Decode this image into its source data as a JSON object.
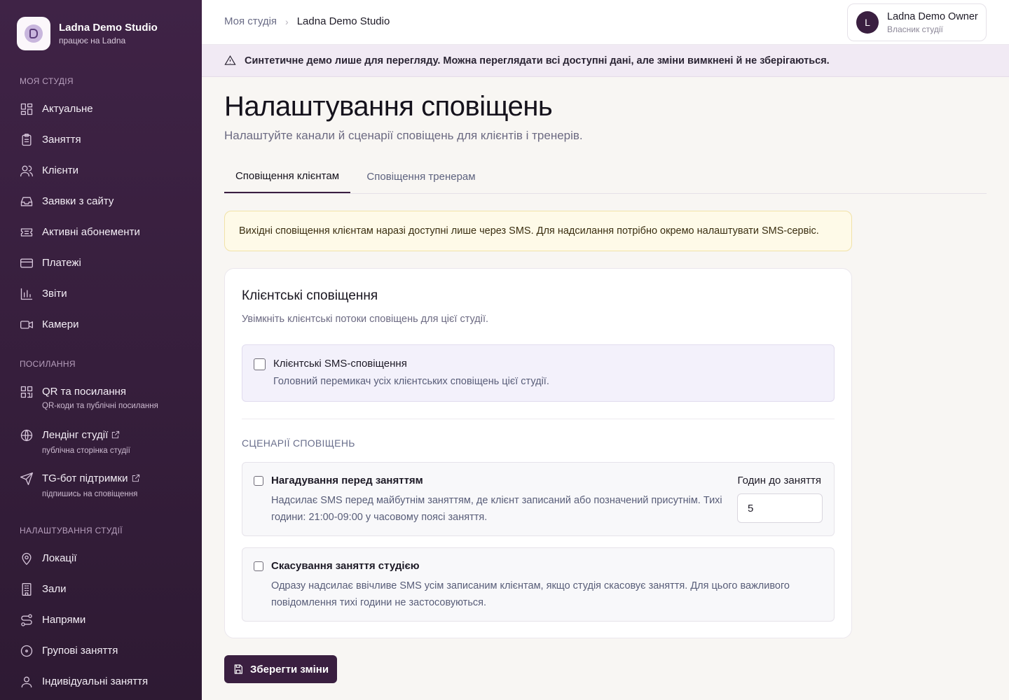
{
  "brand": {
    "name": "Ladna Demo Studio",
    "subtitle": "працює на Ladna"
  },
  "sidebar": {
    "sections": {
      "my_studio": "МОЯ СТУДІЯ",
      "links": "ПОСИЛАННЯ",
      "settings": "НАЛАШТУВАННЯ СТУДІЇ"
    },
    "items": [
      {
        "label": "Актуальне",
        "icon": "dashboard-icon"
      },
      {
        "label": "Заняття",
        "icon": "clipboard-icon"
      },
      {
        "label": "Клієнти",
        "icon": "users-icon"
      },
      {
        "label": "Заявки з сайту",
        "icon": "inbox-icon"
      },
      {
        "label": "Активні абонементи",
        "icon": "ticket-icon"
      },
      {
        "label": "Платежі",
        "icon": "credit-card-icon"
      },
      {
        "label": "Звіти",
        "icon": "bar-chart-icon"
      },
      {
        "label": "Камери",
        "icon": "video-icon"
      }
    ],
    "links": [
      {
        "label": "QR та посилання",
        "sub": "QR-коди та публічні посилання",
        "icon": "qr-icon"
      },
      {
        "label": "Лендінг студії",
        "sub": "публічна сторінка студії",
        "icon": "globe-icon"
      },
      {
        "label": "TG-бот підтримки",
        "sub": "підпишись на сповіщення",
        "icon": "send-icon"
      }
    ],
    "settings": [
      {
        "label": "Локації",
        "icon": "map-pin-icon"
      },
      {
        "label": "Зали",
        "icon": "building-icon"
      },
      {
        "label": "Напрями",
        "icon": "route-icon"
      },
      {
        "label": "Групові заняття",
        "icon": "circle-icon"
      },
      {
        "label": "Індивідуальні заняття",
        "icon": "user-icon"
      }
    ]
  },
  "header": {
    "breadcrumb": [
      "Моя студія",
      "Ladna Demo Studio"
    ],
    "user": {
      "initial": "L",
      "name": "Ladna Demo Owner",
      "role": "Власник студії"
    }
  },
  "demo_banner": "Синтетичне демо лише для перегляду. Можна переглядати всі доступні дані, але зміни вимкнені й не зберігаються.",
  "page": {
    "title": "Налаштування сповіщень",
    "subtitle": "Налаштуйте канали й сценарії сповіщень для клієнтів і тренерів."
  },
  "tabs": [
    {
      "label": "Сповіщення клієнтам",
      "active": true
    },
    {
      "label": "Сповіщення тренерам",
      "active": false
    }
  ],
  "info_note": "Вихідні сповіщення клієнтам наразі доступні лише через SMS. Для надсилання потрібно окремо налаштувати SMS-сервіс.",
  "card": {
    "title": "Клієнтські сповіщення",
    "subtitle": "Увімкніть клієнтські потоки сповіщень для цієї студії.",
    "master": {
      "title": "Клієнтські SMS-сповіщення",
      "desc": "Головний перемикач усіх клієнтських сповіщень цієї студії.",
      "checked": false
    },
    "scenarios_caption": "СЦЕНАРІЇ СПОВІЩЕНЬ",
    "scenarios": [
      {
        "title": "Нагадування перед заняттям",
        "desc_line1": "Надсилає SMS перед майбутнім заняттям, де клієнт записаний або позначений присутнім. Тихі",
        "desc_line2": "години: 21:00-09:00 у часовому поясі заняття.",
        "hours_label": "Годин до заняття",
        "hours_value": "5",
        "checked": false
      },
      {
        "title": "Скасування заняття студією",
        "desc_line1": "Одразу надсилає ввічливе SMS усім записаним клієнтам, якщо студія скасовує заняття. Для цього важливого",
        "desc_line2": "повідомлення тихі години не застосовуються.",
        "checked": false
      }
    ]
  },
  "save_button": "Зберегти зміни",
  "colors": {
    "sidebar": "#3f2346",
    "accent": "#3a1f40",
    "banner": "#f1eaf4",
    "note": "#fefae8"
  }
}
